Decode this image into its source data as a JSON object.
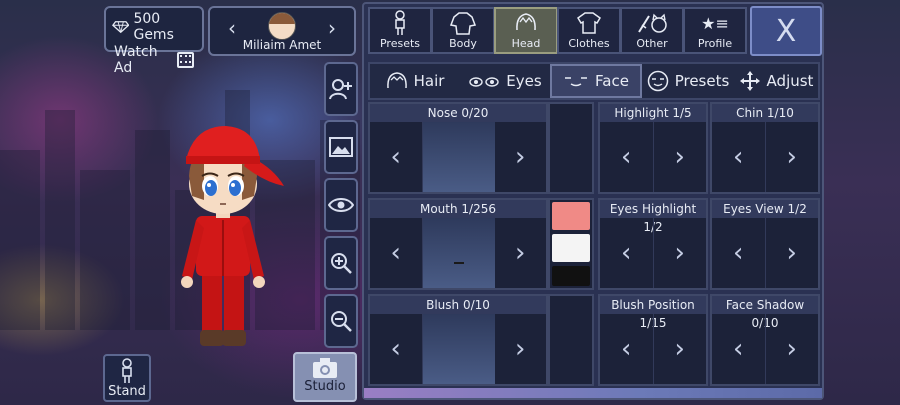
{
  "currency": {
    "gems_label": "500 Gems",
    "watch_ad_label": "Watch Ad"
  },
  "character": {
    "name": "Miliaim Amet",
    "prev_icon": "chevron-left-icon",
    "next_icon": "chevron-right-icon"
  },
  "side_buttons": [
    {
      "name": "add-character-icon"
    },
    {
      "name": "background-image-icon"
    },
    {
      "name": "eye-icon"
    },
    {
      "name": "zoom-in-icon"
    },
    {
      "name": "zoom-out-icon"
    }
  ],
  "stand_label": "Stand",
  "studio_label": "Studio",
  "category_tabs": [
    {
      "label": "Presets",
      "icon": "presets-icon",
      "active": false
    },
    {
      "label": "Body",
      "icon": "body-icon",
      "active": false
    },
    {
      "label": "Head",
      "icon": "head-icon",
      "active": true
    },
    {
      "label": "Clothes",
      "icon": "clothes-icon",
      "active": false
    },
    {
      "label": "Other",
      "icon": "other-icon",
      "active": false
    },
    {
      "label": "Profile",
      "icon": "profile-icon",
      "active": false
    }
  ],
  "close_label": "X",
  "sub_tabs": [
    {
      "label": "Hair",
      "icon": "hair-icon",
      "active": false
    },
    {
      "label": "Eyes",
      "icon": "eyes-icon",
      "active": false
    },
    {
      "label": "Face",
      "icon": "face-icon",
      "active": true
    },
    {
      "label": "Presets",
      "icon": "face-presets-icon",
      "active": false
    },
    {
      "label": "Adjust",
      "icon": "move-icon",
      "active": false
    }
  ],
  "options": {
    "nose": "Nose 0/20",
    "mouth": "Mouth 1/256",
    "blush": "Blush 0/10",
    "highlight": "Highlight 1/5",
    "chin": "Chin 1/10",
    "eyes_highlight": "Eyes Highlight 1/2",
    "eyes_view": "Eyes View 1/2",
    "blush_position": "Blush Position 1/15",
    "face_shadow": "Face Shadow 0/10"
  },
  "colors": {
    "swatch_1": "#f08a86",
    "swatch_2": "#f4f4f4",
    "swatch_3": "#111111",
    "active_tab": "#5a5f52",
    "close_button": "#3e4d87"
  }
}
